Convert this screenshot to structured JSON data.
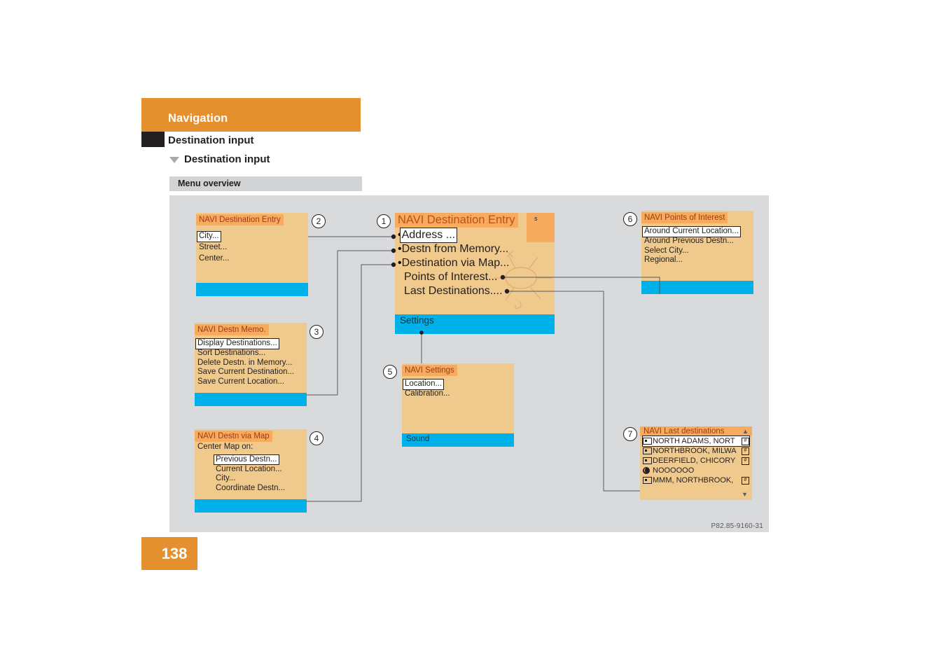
{
  "header": {
    "chapter": "Navigation",
    "section": "Destination input",
    "subsection": "Destination input",
    "subsection_marker_icon": "triangle-down-icon",
    "menu_overview_label": "Menu overview",
    "accent_color": "#e5902f",
    "black_tab_color": "#231f20"
  },
  "footer": {
    "page_number": "138"
  },
  "figure": {
    "code": "P82.85-9160-31",
    "background_color": "#d9dadc",
    "box_body_color": "#f0c98d",
    "box_title_color": "#f7ab5e",
    "box_footer_color": "#00b0e8",
    "title_text_color": "#a03a12"
  },
  "boxes": {
    "box1": {
      "callout": "1",
      "title": "NAVI Destination Entry",
      "corner_mark": "s",
      "items": [
        {
          "label": "Address ...",
          "selected": true,
          "bullet": true
        },
        {
          "label": "Destn from Memory...",
          "selected": false,
          "bullet": true
        },
        {
          "label": "Destination via Map...",
          "selected": false,
          "bullet": true
        },
        {
          "label": "Points of Interest...",
          "selected": false,
          "bullet": false
        },
        {
          "label": "Last Destinations....",
          "selected": false,
          "bullet": false
        }
      ],
      "footer": "Settings"
    },
    "box2": {
      "callout": "2",
      "title": "NAVI Destination Entry",
      "items": [
        {
          "label": "City...",
          "selected": true
        },
        {
          "label": "Street...",
          "selected": false
        },
        {
          "label": "Center...",
          "selected": false
        }
      ],
      "footer": ""
    },
    "box3": {
      "callout": "3",
      "title": "NAVI Destn Memo.",
      "items": [
        {
          "label": "Display Destinations...",
          "selected": true
        },
        {
          "label": "Sort Destinations...",
          "selected": false
        },
        {
          "label": "Delete Destn. in Memory...",
          "selected": false
        },
        {
          "label": "Save Current Destination...",
          "selected": false
        },
        {
          "label": "Save Current Location...",
          "selected": false
        }
      ],
      "footer": ""
    },
    "box4": {
      "callout": "4",
      "title": "NAVI Destn via Map",
      "lead_label": "Center Map on:",
      "items": [
        {
          "label": "Previous Destn...",
          "selected": true
        },
        {
          "label": "Current Location...",
          "selected": false
        },
        {
          "label": "City...",
          "selected": false
        },
        {
          "label": "Coordinate Destn...",
          "selected": false
        }
      ],
      "footer": ""
    },
    "box5": {
      "callout": "5",
      "title": "NAVI Settings",
      "items": [
        {
          "label": "Location...",
          "selected": true
        },
        {
          "label": "Calibration...",
          "selected": false
        }
      ],
      "footer": "Sound"
    },
    "box6": {
      "callout": "6",
      "title": "NAVI Points of Interest",
      "items": [
        {
          "label": "Around Current Location...",
          "selected": true
        },
        {
          "label": "Around Previous Destn...",
          "selected": false
        },
        {
          "label": "Select City...",
          "selected": false
        },
        {
          "label": "Regional...",
          "selected": false
        }
      ],
      "footer": ""
    },
    "box7": {
      "callout": "7",
      "title": "NAVI Last destinations",
      "scroll_up_icon": "caret-up-icon",
      "scroll_down_icon": "caret-down-icon",
      "rows": [
        {
          "left_icon": "card-icon",
          "label": "NORTH ADAMS, NORT",
          "right_icon": "hash-icon",
          "selected": true
        },
        {
          "left_icon": "card-icon",
          "label": "NORTHBROOK, MILWA",
          "right_icon": "hash-icon",
          "selected": false
        },
        {
          "left_icon": "card-icon",
          "label": "DEERFIELD, CHICORY",
          "right_icon": "hash-icon",
          "selected": false
        },
        {
          "left_icon": "globe-icon",
          "label": "NOOOOOO",
          "right_icon": "",
          "selected": false
        },
        {
          "left_icon": "card-icon",
          "label": "MMM, NORTHBROOK,",
          "right_icon": "hash-icon",
          "selected": false
        }
      ],
      "footer": ""
    }
  }
}
